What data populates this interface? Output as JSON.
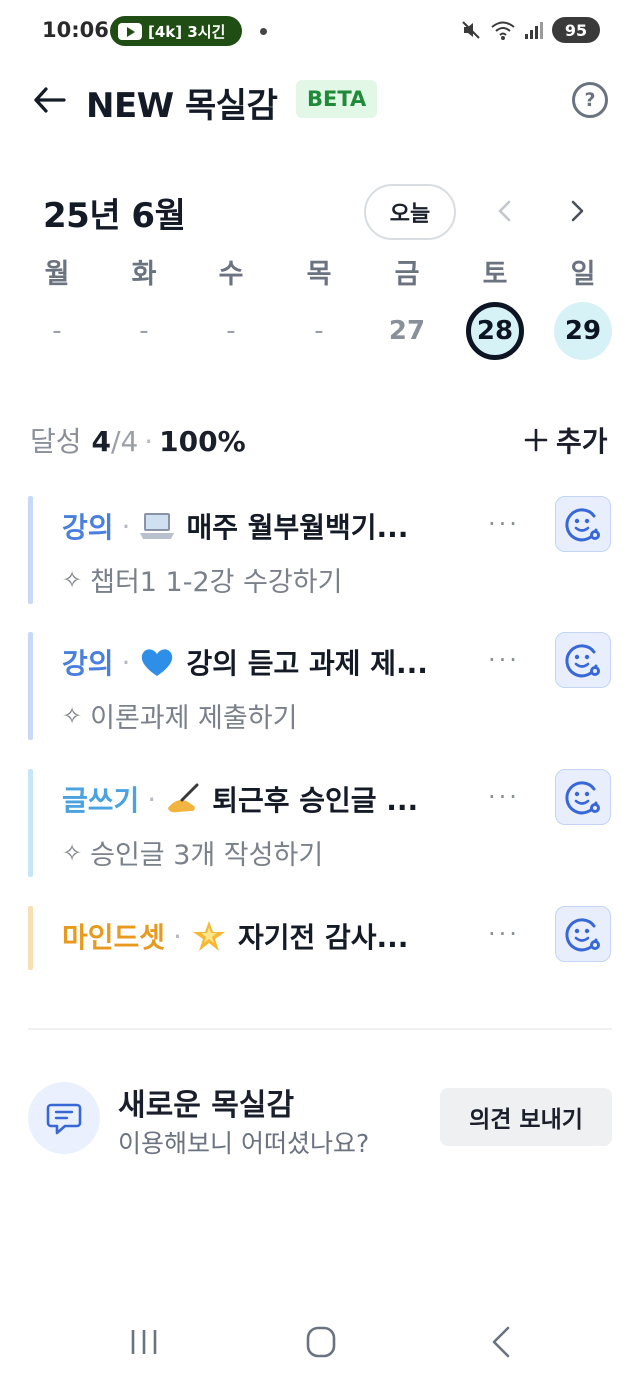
{
  "status_bar": {
    "time": "10:06",
    "media_pill": "[4k] 3시긴",
    "battery": "95"
  },
  "header": {
    "title": "NEW 목실감",
    "badge": "BETA"
  },
  "calendar": {
    "month": "25년 6월",
    "today_button": "오늘",
    "weekdays": [
      "월",
      "화",
      "수",
      "목",
      "금",
      "토",
      "일"
    ],
    "dates": [
      "-",
      "-",
      "-",
      "-",
      "27",
      "28",
      "29"
    ],
    "selected_index": 5,
    "today_index": 6
  },
  "summary": {
    "label": "달성",
    "done": "4",
    "total": "/4",
    "separator": "·",
    "percent": "100%",
    "add_label": "추가"
  },
  "tasks": [
    {
      "category": "강의",
      "category_color": "#4a7fe0",
      "bar_color": "#c9d8f8",
      "emoji_icon": "laptop-icon",
      "title": "매주 월부월백기...",
      "subtitle": "챕터1 1-2강 수강하기",
      "more": "···"
    },
    {
      "category": "강의",
      "category_color": "#4a7fe0",
      "bar_color": "#c9d8f8",
      "emoji_icon": "blue-heart-icon",
      "title": "강의 듣고 과제 제...",
      "subtitle": "이론과제 제출하기",
      "more": "···"
    },
    {
      "category": "글쓰기",
      "category_color": "#4aa3e0",
      "bar_color": "#c6e6f7",
      "emoji_icon": "writing-hand-icon",
      "title": "퇴근후 승인글 ...",
      "subtitle": "승인글 3개 작성하기",
      "more": "···"
    },
    {
      "category": "마인드셋",
      "category_color": "#e89a1f",
      "bar_color": "#f8dfb3",
      "emoji_icon": "glowing-star-icon",
      "title": "자기전 감사...",
      "subtitle": "",
      "more": "···"
    }
  ],
  "feedback": {
    "title": "새로운 목실감",
    "subtitle": "이용해보니 어떠셨나요?",
    "button": "의견 보내기"
  }
}
